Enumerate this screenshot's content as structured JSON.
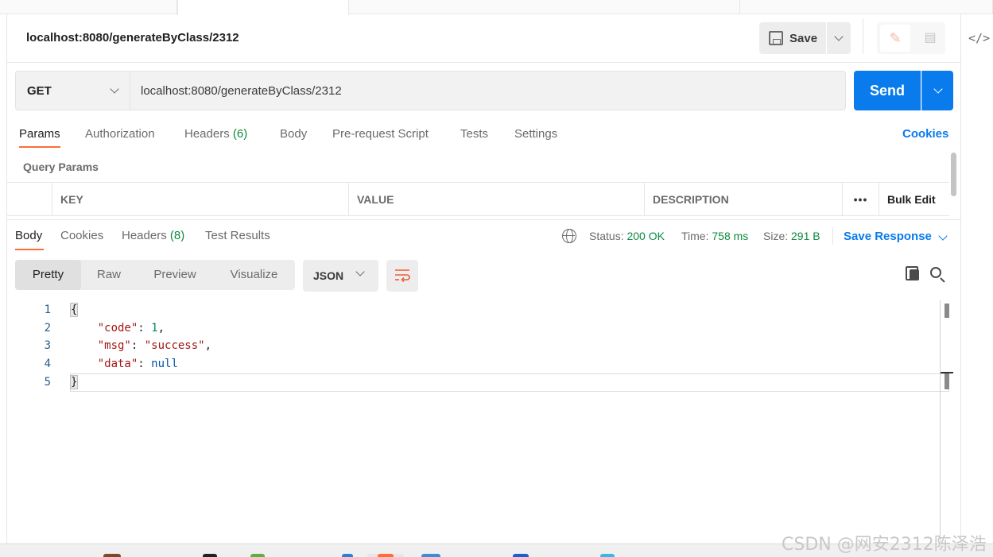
{
  "request_title": "localhost:8080/generateByClass/2312",
  "toolbar": {
    "save_label": "Save"
  },
  "request": {
    "method": "GET",
    "url": "localhost:8080/generateByClass/2312",
    "send_label": "Send"
  },
  "request_tabs": [
    {
      "label": "Params",
      "count": ""
    },
    {
      "label": "Authorization",
      "count": ""
    },
    {
      "label": "Headers",
      "count": "(6)"
    },
    {
      "label": "Body",
      "count": ""
    },
    {
      "label": "Pre-request Script",
      "count": ""
    },
    {
      "label": "Tests",
      "count": ""
    },
    {
      "label": "Settings",
      "count": ""
    }
  ],
  "cookies_link": "Cookies",
  "query_params": {
    "title": "Query Params",
    "columns": [
      "KEY",
      "VALUE",
      "DESCRIPTION"
    ],
    "more": "•••",
    "bulk_edit": "Bulk Edit"
  },
  "response_tabs": [
    {
      "label": "Body",
      "count": ""
    },
    {
      "label": "Cookies",
      "count": ""
    },
    {
      "label": "Headers",
      "count": "(8)"
    },
    {
      "label": "Test Results",
      "count": ""
    }
  ],
  "response_meta": {
    "status_label": "Status:",
    "status_value": "200 OK",
    "time_label": "Time:",
    "time_value": "758 ms",
    "size_label": "Size:",
    "size_value": "291 B",
    "save_response": "Save Response"
  },
  "views": [
    "Pretty",
    "Raw",
    "Preview",
    "Visualize"
  ],
  "format": "JSON",
  "response_body": {
    "line_numbers": [
      "1",
      "2",
      "3",
      "4",
      "5"
    ],
    "open_brace": "{",
    "close_brace": "}",
    "code_key": "\"code\"",
    "code_value": "1",
    "msg_key": "\"msg\"",
    "msg_value": "\"success\"",
    "data_key": "\"data\"",
    "data_value": "null"
  },
  "watermark": "CSDN @网安2312陈泽浩",
  "colors": {
    "accent": "#ff6c37",
    "primary": "#097bed",
    "success": "#0c8a3f"
  }
}
